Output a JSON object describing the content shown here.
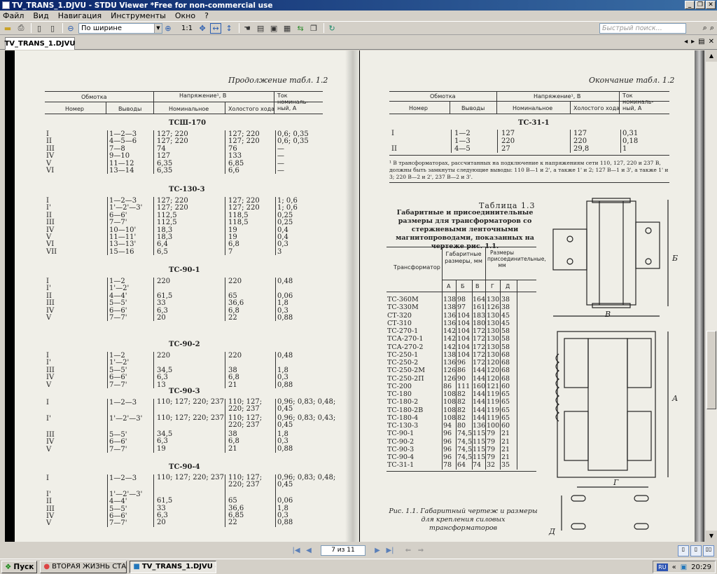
{
  "window": {
    "title": "TV_TRANS_1.DJVU - STDU Viewer *Free for non-commercial use"
  },
  "menu": [
    "Файл",
    "Вид",
    "Навигация",
    "Инструменты",
    "Окно",
    "?"
  ],
  "toolbar": {
    "zoom_value": "По ширине",
    "ratio": "1:1",
    "search_placeholder": "Быстрый поиск..."
  },
  "tab": {
    "label": "TV_TRANS_1.DJVU"
  },
  "navigation": {
    "page_indicator": "7 из 11"
  },
  "left_page": {
    "caption": "Продолжение табл. 1.2",
    "headers": {
      "winding": "Обмотка",
      "voltage": "Напряжение¹, В",
      "current": "Ток номиналь-ный, А",
      "number": "Номер",
      "leads": "Выводы",
      "nominal": "Номинальное",
      "idle": "Холостого хода"
    },
    "sections": [
      {
        "title": "ТСШ-170",
        "rows": [
          [
            "I",
            "1—2—3",
            "127; 220",
            "127; 220",
            "0,6; 0,35"
          ],
          [
            "II",
            "4—5—6",
            "127; 220",
            "127; 220",
            "0,6; 0,35"
          ],
          [
            "III",
            "7—8",
            "74",
            "76",
            "—"
          ],
          [
            "IV",
            "9—10",
            "127",
            "133",
            "—"
          ],
          [
            "V",
            "11—12",
            "6,35",
            "6,85",
            "—"
          ],
          [
            "VI",
            "13—14",
            "6,35",
            "6,6",
            "—"
          ]
        ]
      },
      {
        "title": "ТС-130-3",
        "rows": [
          [
            "I",
            "1—2—3",
            "127; 220",
            "127; 220",
            "1; 0,6"
          ],
          [
            "I'",
            "1'—2'—3'",
            "127; 220",
            "127; 220",
            "1; 0,6"
          ],
          [
            "II",
            "6—6'",
            "112,5",
            "118,5",
            "0,25"
          ],
          [
            "III",
            "7—7'",
            "112,5",
            "118,5",
            "0,25"
          ],
          [
            "IV",
            "10—10'",
            "18,3",
            "19",
            "0,4"
          ],
          [
            "V",
            "11—11'",
            "18,3",
            "19",
            "0,4"
          ],
          [
            "VI",
            "13—13'",
            "6,4",
            "6,8",
            "0,3"
          ],
          [
            "VII",
            "15—16",
            "6,5",
            "7",
            "3"
          ]
        ]
      },
      {
        "title": "ТС-90-1",
        "rows": [
          [
            "I",
            "1—2",
            "220",
            "220",
            "0,48"
          ],
          [
            "I'",
            "1'—2'",
            "",
            "",
            ""
          ],
          [
            "II",
            "4—4'",
            "61,5",
            "65",
            "0,06"
          ],
          [
            "III",
            "5—5'",
            "33",
            "36,6",
            "1,8"
          ],
          [
            "IV",
            "6—6'",
            "6,3",
            "6,8",
            "0,3"
          ],
          [
            "V",
            "7—7'",
            "20",
            "22",
            "0,88"
          ]
        ]
      },
      {
        "title": "ТС-90-2",
        "rows": [
          [
            "I",
            "1—2",
            "220",
            "220",
            "0,48"
          ],
          [
            "I'",
            "1'—2'",
            "",
            "",
            ""
          ],
          [
            "III",
            "5—5'",
            "34,5",
            "38",
            "1,8"
          ],
          [
            "IV",
            "6—6'",
            "6,3",
            "6,8",
            "0,3"
          ],
          [
            "V",
            "7—7'",
            "13",
            "21",
            "0,88"
          ]
        ]
      },
      {
        "title": "ТС-90-3",
        "rows": [
          [
            "I",
            "1—2—3",
            "110; 127; 220; 237",
            "110; 127; 220; 237",
            "0,96; 0,83; 0,48; 0,45"
          ],
          [
            "I'",
            "1'—2'—3'",
            "110; 127; 220; 237",
            "110; 127; 220; 237",
            "0,96; 0,83; 0,43; 0,45"
          ],
          [
            "III",
            "5—5'",
            "34,5",
            "38",
            "1,8"
          ],
          [
            "IV",
            "6—6'",
            "6,3",
            "6,8",
            "0,3"
          ],
          [
            "V",
            "7—7'",
            "19",
            "21",
            "0,88"
          ]
        ]
      },
      {
        "title": "ТС-90-4",
        "rows": [
          [
            "I",
            "1—2—3",
            "110; 127; 220; 237",
            "110; 127; 220; 237",
            "0,96; 0,83; 0,48; 0,45"
          ],
          [
            "I'",
            "1'—2'—3'",
            "",
            "",
            ""
          ],
          [
            "II",
            "4—4'",
            "61,5",
            "65",
            "0,06"
          ],
          [
            "III",
            "5—5'",
            "33",
            "36,6",
            "1,8"
          ],
          [
            "IV",
            "6—6'",
            "6,3",
            "6,85",
            "0,3"
          ],
          [
            "V",
            "7—7'",
            "20",
            "22",
            "0,88"
          ]
        ]
      }
    ]
  },
  "right_page": {
    "caption": "Окончание табл. 1.2",
    "section": {
      "title": "ТС-31-1",
      "rows": [
        [
          "I",
          "1—2",
          "127",
          "127",
          "0,31"
        ],
        [
          "",
          "1—3",
          "220",
          "220",
          "0,18"
        ],
        [
          "II",
          "4—5",
          "27",
          "29,8",
          "1"
        ]
      ]
    },
    "footnote": "¹ В трансформаторах, рассчитанных на подключение к напряжениям сети 110, 127, 220 и 237 В, должны быть замкнуты следующие выводы: 110 В—1 и 2', а также 1' и 2; 127 В—1 и 3', а также 1' и 3; 220 В—2 и 2', 237 В—2 и 3'.",
    "table_label": "Таблица 1.3",
    "table_title": "Габаритные и присоединительные размеры для трансформаторов со стержневыми ленточными магнитопроводами, показанных на чертеже рис. 1.1.",
    "t3_headers": {
      "transformer": "Трансформатор",
      "dims": "Габаритные размеры, мм",
      "mount": "Размеры присоединительные, мм",
      "cols": [
        "А",
        "Б",
        "В",
        "Г",
        "Д"
      ]
    },
    "t3_rows": [
      [
        "ТС-360М",
        "138",
        "98",
        "164",
        "130",
        "38"
      ],
      [
        "ТС-330М",
        "138",
        "97",
        "161",
        "126",
        "38"
      ],
      [
        "СТ-320",
        "136",
        "104",
        "183",
        "130",
        "45"
      ],
      [
        "СТ-310",
        "136",
        "104",
        "180",
        "130",
        "45"
      ],
      [
        "ТС-270-1",
        "142",
        "104",
        "172",
        "130",
        "58"
      ],
      [
        "ТСА-270-1",
        "142",
        "104",
        "172",
        "130",
        "58"
      ],
      [
        "ТСА-270-2",
        "142",
        "104",
        "172",
        "130",
        "58"
      ],
      [
        "ТС-250-1",
        "138",
        "104",
        "172",
        "130",
        "68"
      ],
      [
        "ТС-250-2",
        "136",
        "96",
        "172",
        "120",
        "68"
      ],
      [
        "ТС-250-2М",
        "126",
        "86",
        "144",
        "120",
        "68"
      ],
      [
        "ТС-250-2П",
        "126",
        "90",
        "144",
        "120",
        "68"
      ],
      [
        "ТС-200",
        "86",
        "111",
        "160",
        "121",
        "60"
      ],
      [
        "ТС-180",
        "108",
        "82",
        "144",
        "119",
        "65"
      ],
      [
        "ТС-180-2",
        "108",
        "82",
        "144",
        "119",
        "65"
      ],
      [
        "ТС-180-2В",
        "108",
        "82",
        "144",
        "119",
        "65"
      ],
      [
        "ТС-180-4",
        "108",
        "82",
        "144",
        "119",
        "65"
      ],
      [
        "ТС-130-3",
        "94",
        "80",
        "136",
        "100",
        "60"
      ],
      [
        "ТС-90-1",
        "96",
        "74,5",
        "115",
        "79",
        "21"
      ],
      [
        "ТС-90-2",
        "96",
        "74,5",
        "115",
        "79",
        "21"
      ],
      [
        "ТС-90-3",
        "96",
        "74,5",
        "115",
        "79",
        "21"
      ],
      [
        "ТС-90-4",
        "96",
        "74,5",
        "115",
        "79",
        "21"
      ],
      [
        "ТС-31-1",
        "78",
        "64",
        "74",
        "32",
        "35"
      ]
    ],
    "figure_caption": "Рис. 1.1. Габаритный чертеж и размеры для крепления силовых трансформаторов",
    "drawing_labels": [
      "Б",
      "В",
      "А",
      "Г",
      "Д"
    ]
  },
  "taskbar": {
    "start": "Пуск",
    "tasks": [
      "ВТОРАЯ ЖИЗНЬ СТАРО...",
      "TV_TRANS_1.DJVU - S..."
    ],
    "lang": "RU",
    "clock": "20:29"
  }
}
